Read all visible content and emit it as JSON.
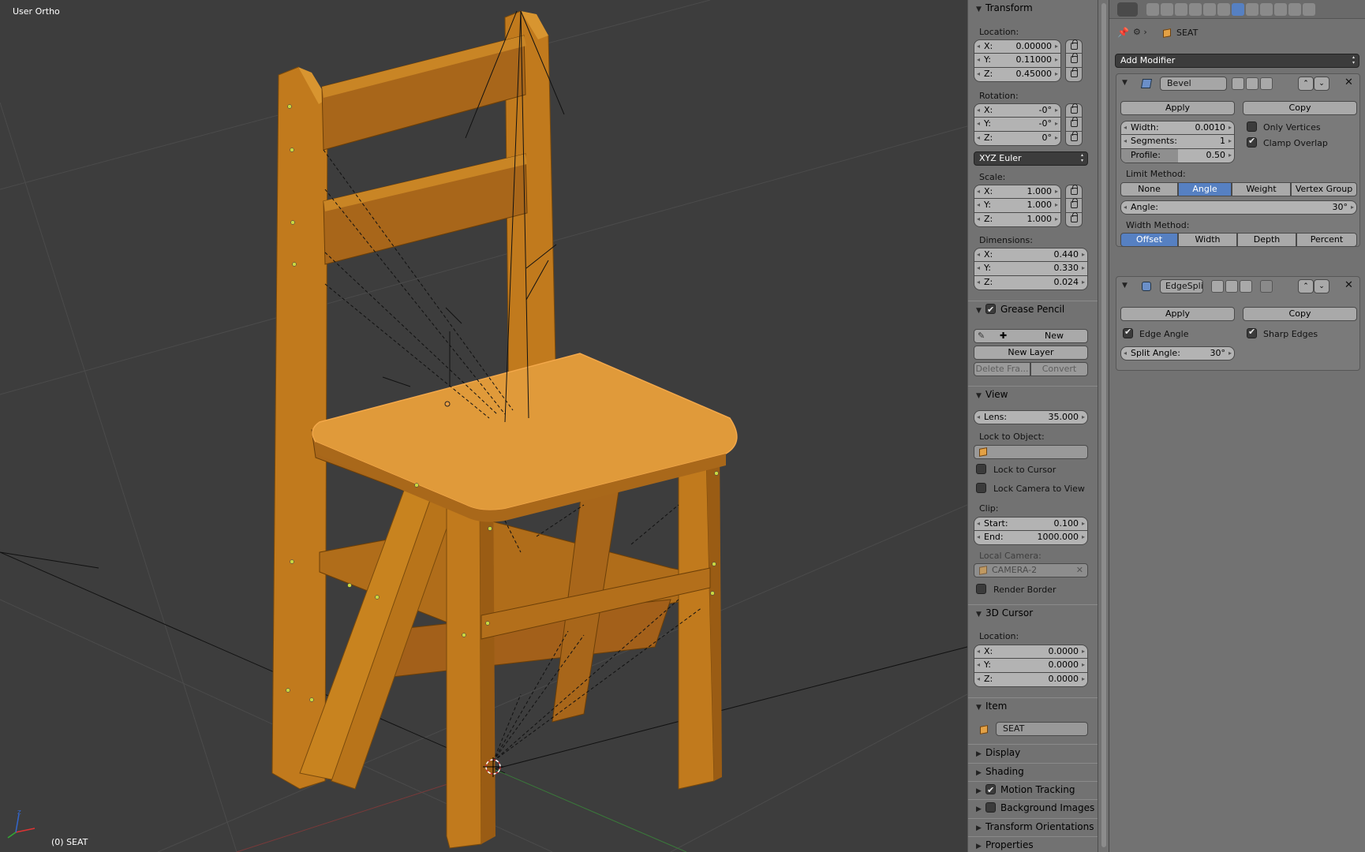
{
  "viewport": {
    "view_label": "User Ortho",
    "object_label": "(0) SEAT"
  },
  "npanel": {
    "transform": {
      "title": "Transform",
      "location_label": "Location:",
      "location": [
        {
          "axis": "X:",
          "value": "0.00000"
        },
        {
          "axis": "Y:",
          "value": "0.11000"
        },
        {
          "axis": "Z:",
          "value": "0.45000"
        }
      ],
      "rotation_label": "Rotation:",
      "rotation": [
        {
          "axis": "X:",
          "value": "-0°"
        },
        {
          "axis": "Y:",
          "value": "-0°"
        },
        {
          "axis": "Z:",
          "value": "0°"
        }
      ],
      "rotation_mode": "XYZ Euler",
      "scale_label": "Scale:",
      "scale": [
        {
          "axis": "X:",
          "value": "1.000"
        },
        {
          "axis": "Y:",
          "value": "1.000"
        },
        {
          "axis": "Z:",
          "value": "1.000"
        }
      ],
      "dimensions_label": "Dimensions:",
      "dimensions": [
        {
          "axis": "X:",
          "value": "0.440"
        },
        {
          "axis": "Y:",
          "value": "0.330"
        },
        {
          "axis": "Z:",
          "value": "0.024"
        }
      ]
    },
    "grease_pencil": {
      "title": "Grease Pencil",
      "new": "New",
      "new_layer": "New Layer",
      "delete_frame": "Delete Fra...",
      "convert": "Convert"
    },
    "view": {
      "title": "View",
      "lens_label": "Lens:",
      "lens": "35.000",
      "lock_object_label": "Lock to Object:",
      "lock_cursor": "Lock to Cursor",
      "lock_camera": "Lock Camera to View",
      "clip_label": "Clip:",
      "clip_start_label": "Start:",
      "clip_start": "0.100",
      "clip_end_label": "End:",
      "clip_end": "1000.000",
      "local_camera_label": "Local Camera:",
      "local_camera": "CAMERA-2",
      "render_border": "Render Border"
    },
    "cursor": {
      "title": "3D Cursor",
      "location_label": "Location:",
      "location": [
        {
          "axis": "X:",
          "value": "0.0000"
        },
        {
          "axis": "Y:",
          "value": "0.0000"
        },
        {
          "axis": "Z:",
          "value": "0.0000"
        }
      ]
    },
    "item": {
      "title": "Item",
      "name": "SEAT"
    },
    "collapsed": [
      {
        "title": "Display",
        "check": null
      },
      {
        "title": "Shading",
        "check": null
      },
      {
        "title": "Motion Tracking",
        "check": true
      },
      {
        "title": "Background Images",
        "check": false
      },
      {
        "title": "Transform Orientations",
        "check": null
      },
      {
        "title": "Properties",
        "check": null
      }
    ]
  },
  "props": {
    "breadcrumb": "SEAT",
    "add_modifier": "Add Modifier",
    "bevel": {
      "name": "Bevel",
      "apply": "Apply",
      "copy": "Copy",
      "width_label": "Width:",
      "width": "0.0010",
      "segments_label": "Segments:",
      "segments": "1",
      "profile_label": "Profile:",
      "profile": "0.50",
      "profile_fraction": 0.5,
      "only_vertices": "Only Vertices",
      "clamp_overlap": "Clamp Overlap",
      "limit_method_label": "Limit Method:",
      "limit_methods": [
        "None",
        "Angle",
        "Weight",
        "Vertex Group"
      ],
      "limit_active": 1,
      "angle_label": "Angle:",
      "angle": "30°",
      "width_method_label": "Width Method:",
      "width_methods": [
        "Offset",
        "Width",
        "Depth",
        "Percent"
      ],
      "width_active": 0
    },
    "edgesplit": {
      "name": "EdgeSpli",
      "apply": "Apply",
      "copy": "Copy",
      "edge_angle": "Edge Angle",
      "sharp_edges": "Sharp Edges",
      "split_angle_label": "Split Angle:",
      "split_angle": "30°"
    }
  },
  "colors": {
    "wood": "#c47d1e",
    "wood_dark": "#8a5410",
    "wood_light": "#e09a3a",
    "accent": "#5680c2",
    "grid": "#4a4a4a"
  }
}
